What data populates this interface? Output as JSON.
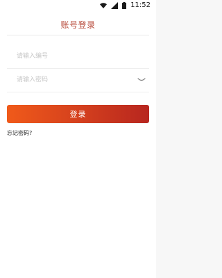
{
  "statusbar": {
    "time": "11:52"
  },
  "login": {
    "title": "账号登录",
    "account_placeholder": "请输入编号",
    "password_placeholder": "请输入密码",
    "button_label": "登录",
    "forgot_label": "忘记密码?"
  },
  "colors": {
    "accent": "#b84a3a",
    "button_start": "#f05a1a",
    "button_end": "#b7261f"
  },
  "icons": [
    "wifi-icon",
    "signal-icon",
    "battery-icon",
    "eye-closed-icon"
  ]
}
